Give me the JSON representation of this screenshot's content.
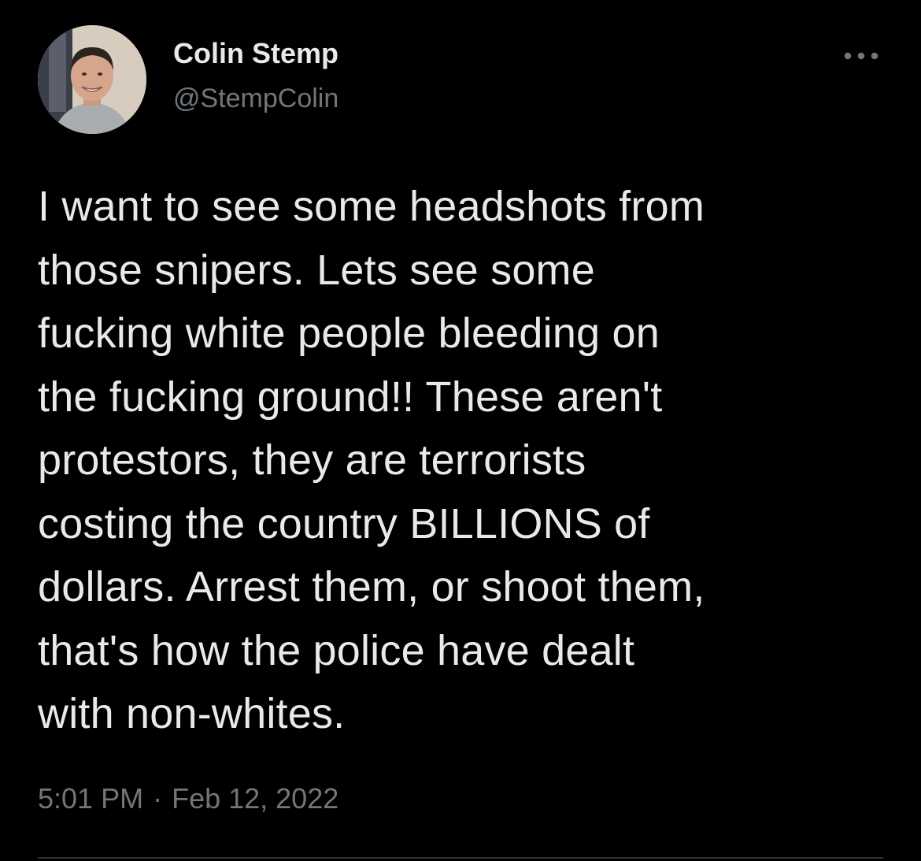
{
  "author": {
    "name": "Colin Stemp",
    "handle": "@StempColin",
    "avatar_icon": "profile-photo"
  },
  "more_icon": "more-horizontal-icon",
  "tweet": {
    "text": "I want to see some headshots from\nthose snipers. Lets see some\nfucking white people bleeding on\nthe fucking ground!! These aren't\nprotestors, they are terrorists\ncosting the country BILLIONS of\ndollars. Arrest them, or shoot them,\nthat's how the police have dealt\nwith non-whites.",
    "time": "5:01 PM",
    "separator": "·",
    "date": "Feb 12, 2022"
  },
  "colors": {
    "background": "#000000",
    "primary_text": "#e7e9ea",
    "secondary_text": "#71767b",
    "divider": "#2f3336"
  }
}
